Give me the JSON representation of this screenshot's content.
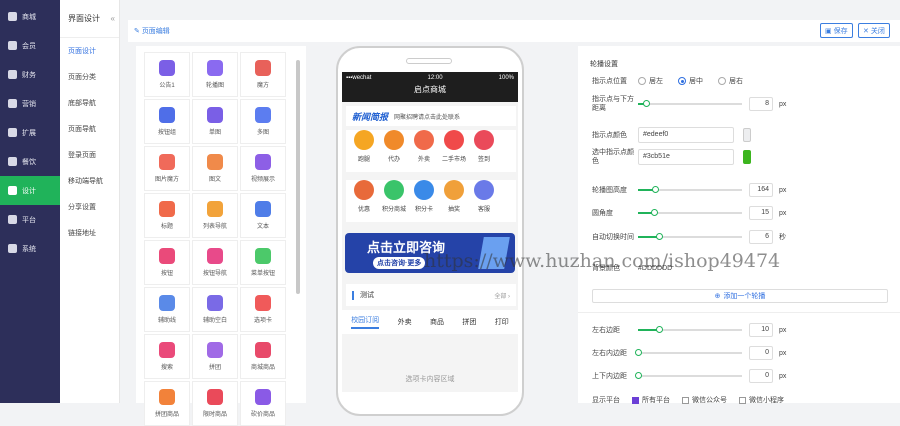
{
  "nav": {
    "items": [
      {
        "label": "商城"
      },
      {
        "label": "会员"
      },
      {
        "label": "财务"
      },
      {
        "label": "营销"
      },
      {
        "label": "扩展"
      },
      {
        "label": "餐饮"
      },
      {
        "label": "设计",
        "active": true
      },
      {
        "label": "平台"
      },
      {
        "label": "系统"
      }
    ]
  },
  "subnav": {
    "title": "界面设计",
    "collapse": "«",
    "items": [
      {
        "label": "页面设计",
        "active": true
      },
      {
        "label": "页面分类"
      },
      {
        "label": "底部导航"
      },
      {
        "label": "页面导航"
      },
      {
        "label": "登录页面"
      },
      {
        "label": "移动端导航"
      },
      {
        "label": "分享设置"
      },
      {
        "label": "链接地址"
      }
    ]
  },
  "topbar": {
    "title": "页面编辑",
    "save": "保存",
    "close": "关闭"
  },
  "components": [
    {
      "label": "公告1",
      "color": "#7b5fe6"
    },
    {
      "label": "轮播图",
      "color": "#8a6af0"
    },
    {
      "label": "魔方",
      "color": "#e8615a"
    },
    {
      "label": "按钮组",
      "color": "#4f6ee8"
    },
    {
      "label": "单图",
      "color": "#7a5fe6"
    },
    {
      "label": "多图",
      "color": "#5c7df0"
    },
    {
      "label": "图片魔方",
      "color": "#f06a5a"
    },
    {
      "label": "图文",
      "color": "#f08a4a"
    },
    {
      "label": "视频展示",
      "color": "#8d5fe6"
    },
    {
      "label": "标题",
      "color": "#f06a4a"
    },
    {
      "label": "列表导航",
      "color": "#f2a33a"
    },
    {
      "label": "文本",
      "color": "#4f7de8"
    },
    {
      "label": "按钮",
      "color": "#ea4a7a"
    },
    {
      "label": "按钮导航",
      "color": "#e84a8a"
    },
    {
      "label": "菜单按钮",
      "color": "#4cc96a"
    },
    {
      "label": "辅助线",
      "color": "#5a8ae8"
    },
    {
      "label": "辅助空白",
      "color": "#7a6ae6"
    },
    {
      "label": "选项卡",
      "color": "#f05a5a"
    },
    {
      "label": "搜索",
      "color": "#ea4a7a"
    },
    {
      "label": "拼团",
      "color": "#a06ae6"
    },
    {
      "label": "商城商品",
      "color": "#e84a6a"
    },
    {
      "label": "拼团商品",
      "color": "#f2823a"
    },
    {
      "label": "限时商品",
      "color": "#ea4a5a"
    },
    {
      "label": "砍价商品",
      "color": "#8a5ae6"
    }
  ],
  "phone": {
    "carrier": "wechat",
    "time": "12:00",
    "battery": "100%",
    "app_title": "启点商城",
    "news_logo": "新闻简报",
    "news_text": "网聚招聘请点击此处联系",
    "icons_row1": [
      {
        "label": "跑腿",
        "color": "#f5a623"
      },
      {
        "label": "代办",
        "color": "#f08a2a"
      },
      {
        "label": "外卖",
        "color": "#f06a4a"
      },
      {
        "label": "二手市场",
        "color": "#f04a4a"
      },
      {
        "label": "签到",
        "color": "#ea4a5a"
      }
    ],
    "icons_row2": [
      {
        "label": "优惠",
        "color": "#e86a3a"
      },
      {
        "label": "积分商城",
        "color": "#3ac46a"
      },
      {
        "label": "积分卡",
        "color": "#3a8ae8"
      },
      {
        "label": "抽奖",
        "color": "#f0a03a"
      },
      {
        "label": "客服",
        "color": "#6a7ae8"
      }
    ],
    "banner_title": "点击立即咨询",
    "banner_sub": "点击咨询·更多",
    "announcement": "测试",
    "announcement_more": "全部 ›",
    "tabs": [
      "校园订阅",
      "外卖",
      "商品",
      "拼团",
      "打印"
    ],
    "tab_content": "选项卡内容区域"
  },
  "settings": {
    "section": "轮播设置",
    "indicator_pos_label": "指示点位置",
    "indicator_options": [
      "居左",
      "居中",
      "居右"
    ],
    "indicator_selected": "居中",
    "indicator_bottom_label": "指示点与下方距离",
    "indicator_bottom": 8,
    "indicator_bottom_max": 100,
    "indicator_color_label": "指示点颜色",
    "indicator_color": "#edeef0",
    "selected_color_label": "选中指示点颜色",
    "selected_color": "#3cb51e",
    "height_label": "轮播图高度",
    "height": 164,
    "height_max": 1000,
    "radius_label": "圆角度",
    "radius": 15,
    "radius_max": 100,
    "autoplay_label": "自动切换时间",
    "autoplay": 6,
    "autoplay_max": 30,
    "bg_label": "背景颜色",
    "bg_value": "#DDDDDD",
    "add_label": "添加一个轮播",
    "lr_margin_label": "左右边距",
    "lr_margin": 10,
    "lr_margin_max": 50,
    "lr_padding_label": "左右内边距",
    "lr_padding": 0,
    "tb_padding_label": "上下内边距",
    "tb_padding": 0,
    "platform_label": "显示平台",
    "platforms": [
      {
        "label": "所有平台",
        "checked": true
      },
      {
        "label": "微信公众号",
        "checked": false
      },
      {
        "label": "微信小程序",
        "checked": false
      }
    ],
    "unit_px": "px",
    "unit_sec": "秒"
  },
  "watermark": "https://www.huzhan.com/ishop49474"
}
